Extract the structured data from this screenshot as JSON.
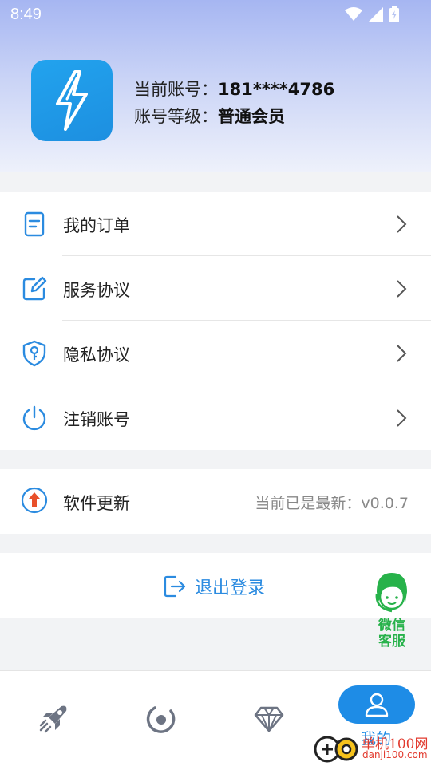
{
  "status_bar": {
    "time": "8:49"
  },
  "profile": {
    "account_label": "当前账号：",
    "account_value": "181****4786",
    "level_label": "账号等级：",
    "level_value": "普通会员"
  },
  "menu": {
    "items": [
      {
        "label": "我的订单",
        "icon": "order-doc-icon"
      },
      {
        "label": "服务协议",
        "icon": "edit-icon"
      },
      {
        "label": "隐私协议",
        "icon": "shield-key-icon"
      },
      {
        "label": "注销账号",
        "icon": "power-icon"
      }
    ]
  },
  "update": {
    "label": "软件更新",
    "value": "当前已是最新：v0.0.7",
    "icon": "update-arrow-icon"
  },
  "logout": {
    "label": "退出登录",
    "icon": "logout-icon"
  },
  "service": {
    "line1": "微信",
    "line2": "客服"
  },
  "tabbar": {
    "tabs": [
      {
        "name": "rocket-icon"
      },
      {
        "name": "orbit-icon"
      },
      {
        "name": "diamond-icon"
      },
      {
        "name": "user-icon",
        "label": "我的"
      }
    ]
  },
  "watermark": {
    "text": "单机100网",
    "url": "danji100.com"
  },
  "colors": {
    "accent": "#1e8ce6",
    "service_green": "#27b24a",
    "watermark_red": "#e23b2f"
  }
}
